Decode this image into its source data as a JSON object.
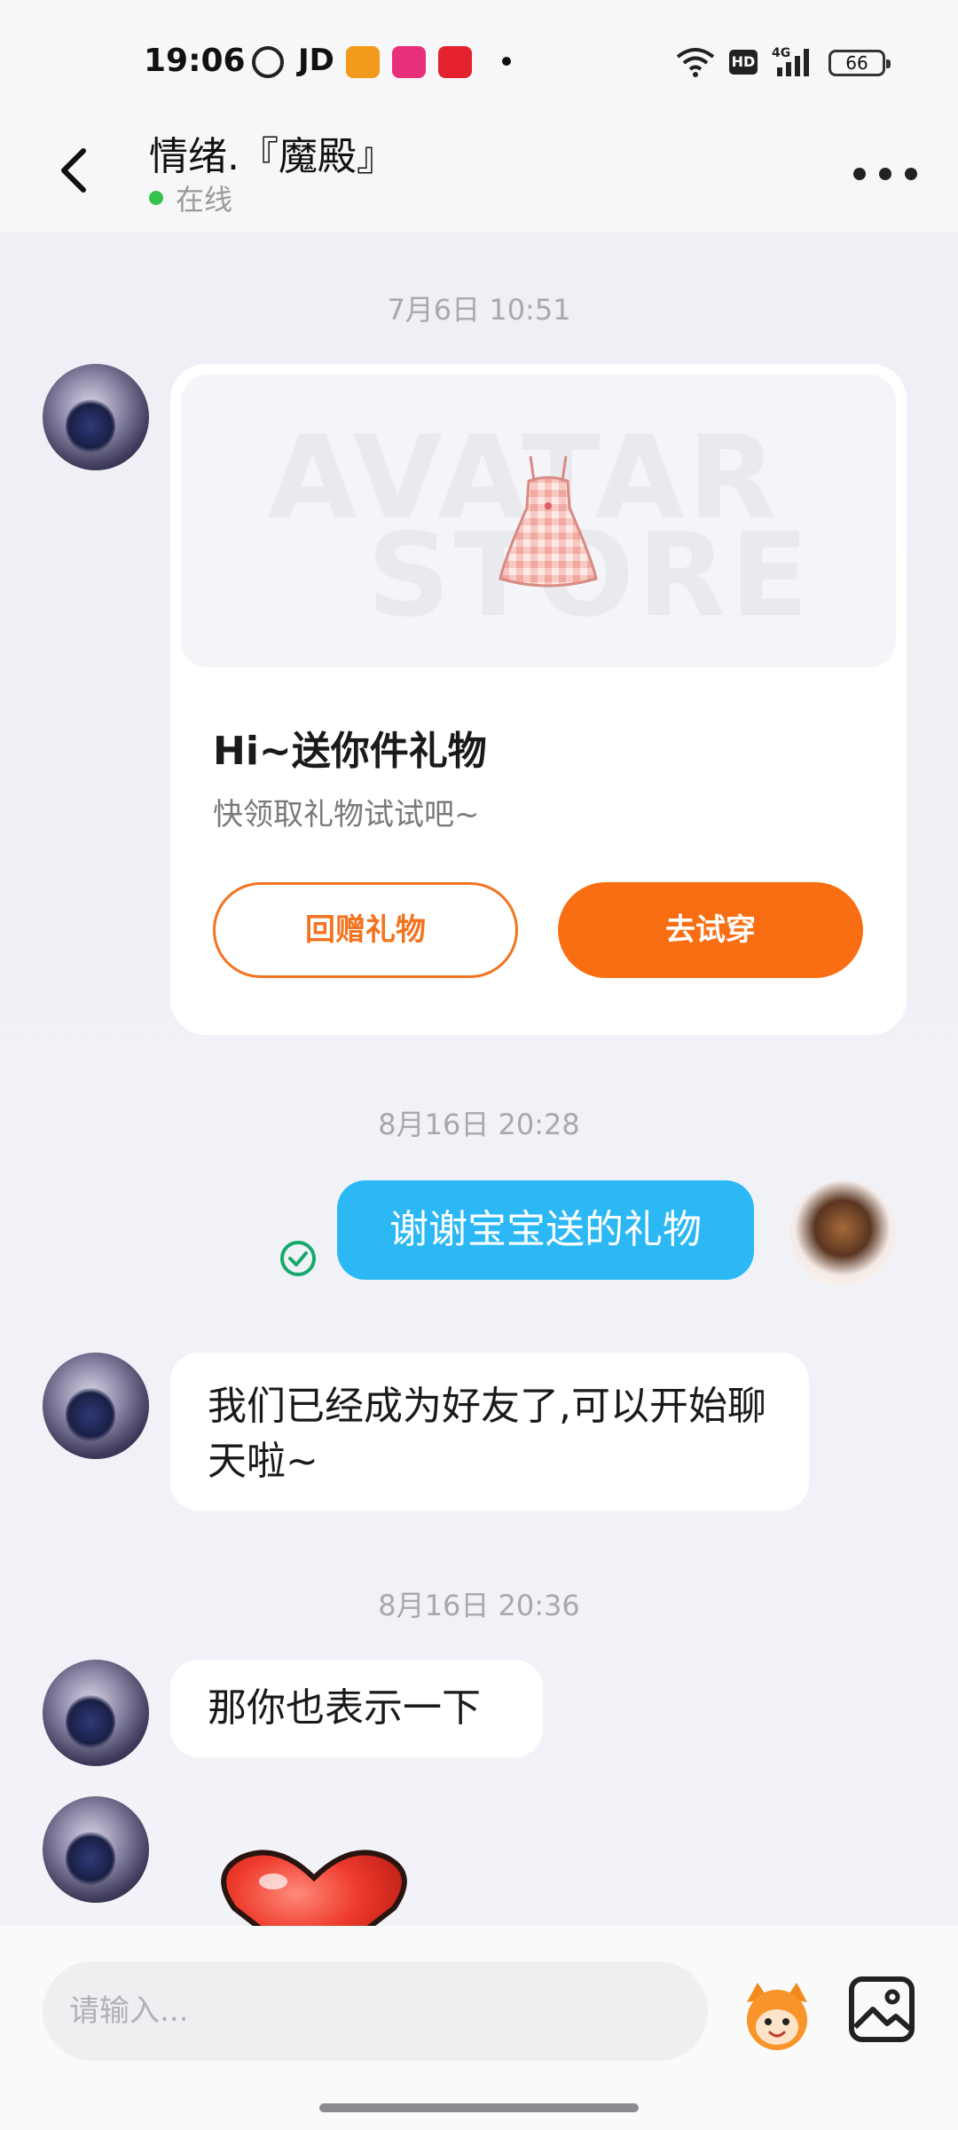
{
  "status_bar": {
    "time": "19:06",
    "app_icons": [
      "chat-bubble-icon",
      "jd-icon",
      "orange-app-icon",
      "pink-app-icon",
      "red-app-icon"
    ],
    "jd_label": "JD",
    "hd_label": "HD",
    "battery": "66"
  },
  "header": {
    "contact_name": "情绪.『魔殿』",
    "status_label": "在线",
    "status_color": "#33c24d"
  },
  "messages": {
    "timestamp_1": "7月6日 10:51",
    "gift_card": {
      "watermark_1": "AVATAR",
      "watermark_2": "STORE",
      "title": "Hi~送你件礼物",
      "subtitle": "快领取礼物试试吧~",
      "return_gift_label": "回赠礼物",
      "try_on_label": "去试穿"
    },
    "timestamp_2": "8月16日 20:28",
    "outgoing_1": "谢谢宝宝送的礼物",
    "incoming_1": "我们已经成为好友了,可以开始聊天啦~",
    "timestamp_3": "8月16日 20:36",
    "incoming_2": "那你也表示一下"
  },
  "input_bar": {
    "placeholder": "请输入..."
  },
  "colors": {
    "accent_orange": "#fa6e13",
    "outgoing_bubble": "#2bb8f5",
    "read_check": "#17a96b"
  }
}
